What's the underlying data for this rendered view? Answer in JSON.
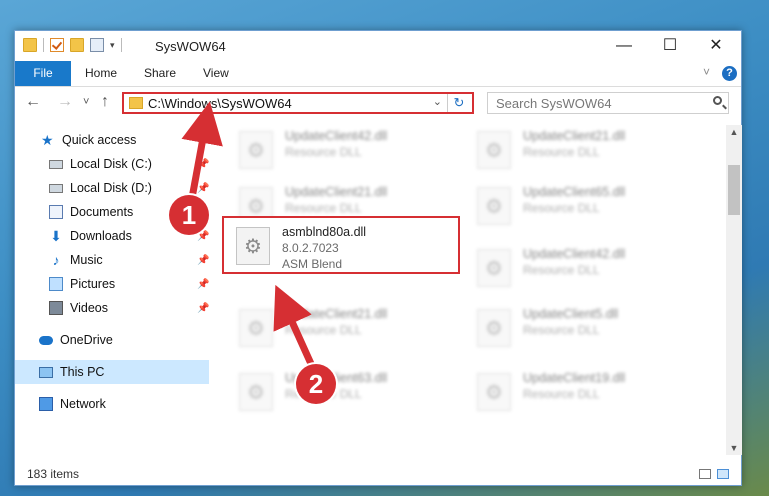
{
  "window": {
    "title": "SysWOW64",
    "controls": {
      "minimize": "—",
      "maximize": "☐",
      "close": "✕"
    }
  },
  "ribbon": {
    "tabs": [
      "File",
      "Home",
      "Share",
      "View"
    ],
    "help_label": "?"
  },
  "nav": {
    "back": "←",
    "forward": "→",
    "recent": "˅",
    "up": "↑",
    "address": "C:\\Windows\\SysWOW64",
    "dropdown": "⌄",
    "refresh": "↻",
    "search_placeholder": "Search SysWOW64"
  },
  "sidebar": {
    "items": [
      {
        "label": "Quick access",
        "icon": "star-icon",
        "pinned": false
      },
      {
        "label": "Local Disk (C:)",
        "icon": "disk-icon",
        "pinned": true
      },
      {
        "label": "Local Disk (D:)",
        "icon": "disk-icon",
        "pinned": true
      },
      {
        "label": "Documents",
        "icon": "documents-icon",
        "pinned": true
      },
      {
        "label": "Downloads",
        "icon": "download-icon",
        "pinned": true
      },
      {
        "label": "Music",
        "icon": "music-icon",
        "pinned": true
      },
      {
        "label": "Pictures",
        "icon": "pictures-icon",
        "pinned": true
      },
      {
        "label": "Videos",
        "icon": "videos-icon",
        "pinned": true
      },
      {
        "label": "OneDrive",
        "icon": "cloud-icon",
        "pinned": false
      },
      {
        "label": "This PC",
        "icon": "pc-icon",
        "pinned": false,
        "selected": true
      },
      {
        "label": "Network",
        "icon": "network-icon",
        "pinned": false
      }
    ],
    "pin_glyph": "📌"
  },
  "files": {
    "left": [
      {
        "name": "UpdateClient42.dll",
        "desc": "Resource DLL"
      },
      {
        "name": "UpdateClient21.dll",
        "desc": "Resource DLL"
      },
      {
        "name": "UpdateClient21.dll",
        "desc": "Resource DLL"
      },
      {
        "name": "UpdateClient63.dll",
        "desc": "Resource DLL"
      }
    ],
    "right": [
      {
        "name": "UpdateClient21.dll",
        "desc": "Resource DLL"
      },
      {
        "name": "UpdateClient65.dll",
        "desc": "Resource DLL"
      },
      {
        "name": "UpdateClient42.dll",
        "desc": "Resource DLL"
      },
      {
        "name": "UpdateClient5.dll",
        "desc": "Resource DLL"
      },
      {
        "name": "UpdateClient19.dll",
        "desc": "Resource DLL"
      }
    ],
    "highlighted": {
      "name": "asmblnd80a.dll",
      "version": "8.0.2.7023",
      "desc": "ASM Blend"
    }
  },
  "status": {
    "item_count": "183 items"
  },
  "callouts": {
    "one": "1",
    "two": "2"
  },
  "colors": {
    "accent": "#1979ca",
    "callout": "#d62f33",
    "selected": "#cce8ff"
  }
}
